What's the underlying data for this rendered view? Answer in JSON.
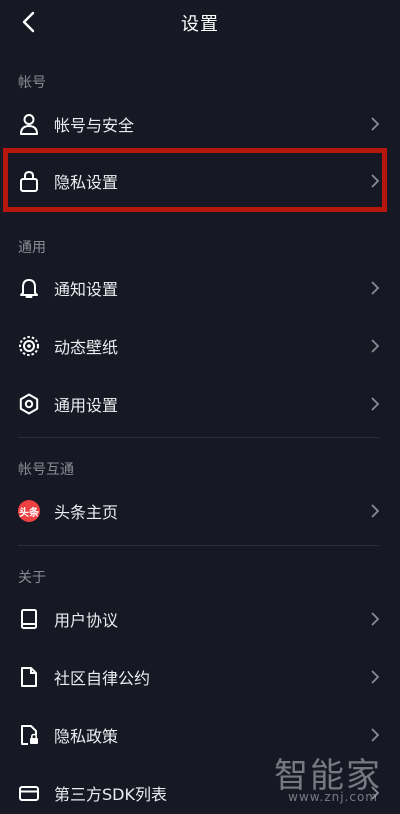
{
  "header": {
    "title": "设置"
  },
  "sections": [
    {
      "title": "帐号",
      "items": [
        {
          "label": "帐号与安全",
          "icon": "user-icon"
        },
        {
          "label": "隐私设置",
          "icon": "lock-icon"
        }
      ]
    },
    {
      "title": "通用",
      "items": [
        {
          "label": "通知设置",
          "icon": "bell-icon"
        },
        {
          "label": "动态壁纸",
          "icon": "live-wallpaper-icon"
        },
        {
          "label": "通用设置",
          "icon": "gear-icon"
        }
      ]
    },
    {
      "title": "帐号互通",
      "items": [
        {
          "label": "头条主页",
          "icon": "toutiao-logo-icon",
          "badge": "头条"
        }
      ]
    },
    {
      "title": "关于",
      "items": [
        {
          "label": "用户协议",
          "icon": "book-icon"
        },
        {
          "label": "社区自律公约",
          "icon": "document-icon"
        },
        {
          "label": "隐私政策",
          "icon": "document-lock-icon"
        },
        {
          "label": "第三方SDK列表",
          "icon": "card-icon"
        }
      ]
    }
  ],
  "watermark": {
    "name": "智能家",
    "url": "www.znj.com"
  },
  "colors": {
    "background": "#161823",
    "highlight": "#b5160d",
    "text": "#ececf0",
    "section": "#8a8b94"
  }
}
